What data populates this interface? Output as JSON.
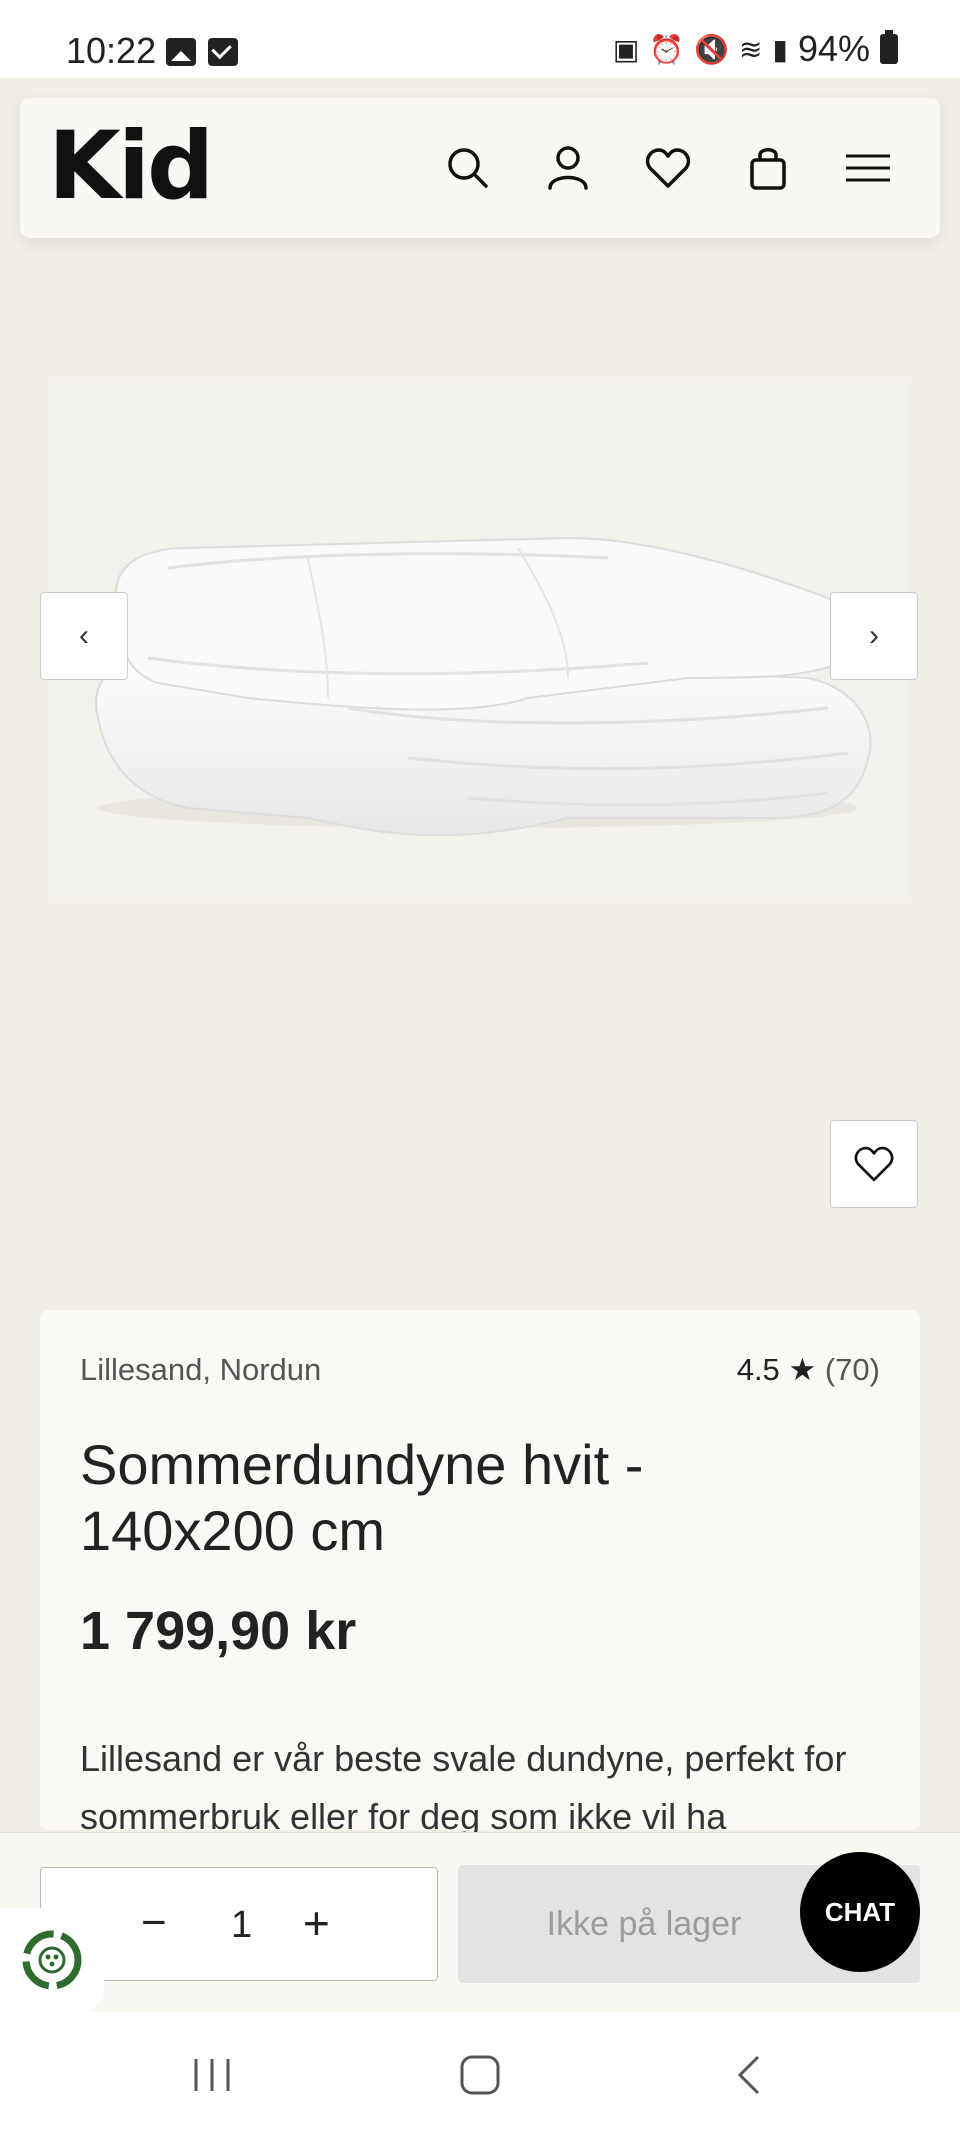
{
  "status_bar": {
    "time": "10:22",
    "battery_text": "94%",
    "icons_left": [
      "gallery-icon",
      "mail-icon"
    ],
    "icons_right": [
      "nfc-icon",
      "alarm-icon",
      "mute-icon",
      "wifi-icon",
      "signal-icon",
      "battery-icon"
    ]
  },
  "header": {
    "logo": "Kid",
    "icons": [
      "search-icon",
      "account-icon",
      "heart-icon",
      "bag-icon",
      "menu-icon"
    ]
  },
  "gallery": {
    "prev_label": "‹",
    "next_label": "›"
  },
  "product": {
    "brand": "Lillesand, Nordun",
    "rating": "4.5",
    "rating_star": "★",
    "rating_count": "(70)",
    "title": "Sommerdundyne hvit - 140x200 cm",
    "price": "1 799,90 kr",
    "description": "Lillesand er vår beste svale dundyne, perfekt for sommerbruk eller for deg som ikke vil ha"
  },
  "actions": {
    "qty_minus": "−",
    "qty_value": "1",
    "qty_plus": "+",
    "stock_label": "Ikke på lager",
    "chat_label": "CHAT"
  },
  "colors": {
    "page_bg": "#f2efe7",
    "card_bg": "#faf9f5",
    "chat_bg": "#000000",
    "disabled_button": "#e3e3e3",
    "eco_green": "#2e6b2e"
  }
}
